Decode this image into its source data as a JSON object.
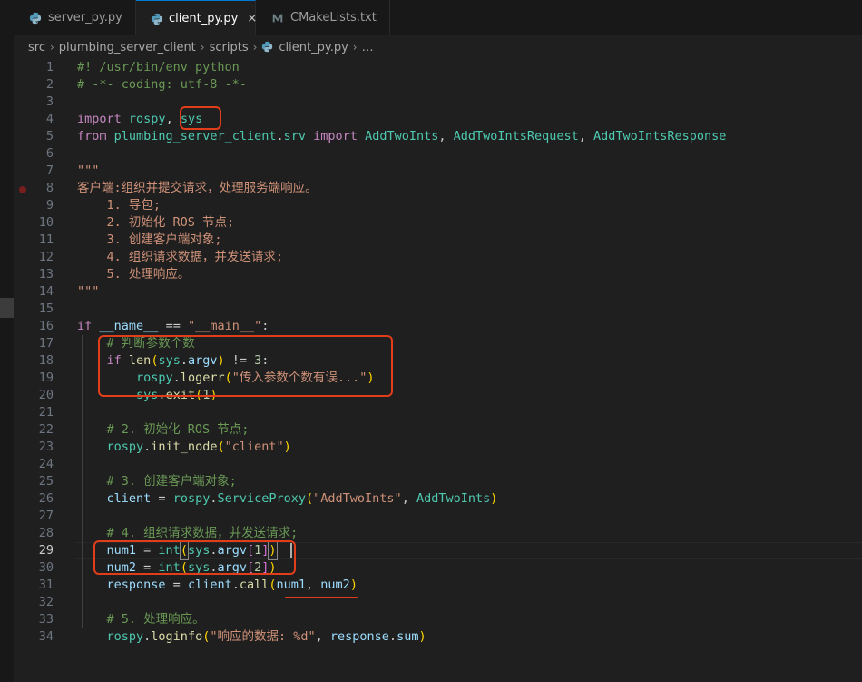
{
  "tabs": [
    {
      "label": "server_py.py",
      "icon": "python-icon"
    },
    {
      "label": "client_py.py",
      "icon": "python-icon",
      "close": "×"
    },
    {
      "label": "CMakeLists.txt",
      "icon": "cmake-icon"
    }
  ],
  "breadcrumb": {
    "parts": [
      "src",
      "plumbing_server_client",
      "scripts",
      "client_py.py",
      "…"
    ]
  },
  "active_line": 29,
  "breakpoint_line": 8,
  "colors": {
    "keyword": "#c586c0",
    "function": "#dcdcaa",
    "variable": "#9cdcfe",
    "string": "#ce9178",
    "comment": "#6a9955",
    "number": "#b5cea8",
    "class": "#4ec9b0",
    "annotation": "#e03e1a"
  },
  "lines": [
    {
      "n": "1",
      "tokens": [
        {
          "t": "#! /usr/bin/env python",
          "c": "cm"
        }
      ]
    },
    {
      "n": "2",
      "tokens": [
        {
          "t": "# -*- coding: utf-8 -*-",
          "c": "cm"
        }
      ]
    },
    {
      "n": "3",
      "tokens": []
    },
    {
      "n": "4",
      "tokens": [
        {
          "t": "import",
          "c": "kw"
        },
        {
          "t": " "
        },
        {
          "t": "rospy",
          "c": "cls"
        },
        {
          "t": ", "
        },
        {
          "t": "sys",
          "c": "cls"
        }
      ]
    },
    {
      "n": "5",
      "tokens": [
        {
          "t": "from",
          "c": "kw"
        },
        {
          "t": " "
        },
        {
          "t": "plumbing_server_client",
          "c": "cls"
        },
        {
          "t": "."
        },
        {
          "t": "srv",
          "c": "cls"
        },
        {
          "t": " "
        },
        {
          "t": "import",
          "c": "kw"
        },
        {
          "t": " "
        },
        {
          "t": "AddTwoInts",
          "c": "cls"
        },
        {
          "t": ", "
        },
        {
          "t": "AddTwoIntsRequest",
          "c": "cls"
        },
        {
          "t": ", "
        },
        {
          "t": "AddTwoIntsResponse",
          "c": "cls"
        }
      ]
    },
    {
      "n": "6",
      "tokens": []
    },
    {
      "n": "7",
      "tokens": [
        {
          "t": "\"\"\"",
          "c": "str"
        }
      ]
    },
    {
      "n": "8",
      "tokens": [
        {
          "t": "客户端:组织并提交请求，处理服务端响应。",
          "c": "str"
        }
      ]
    },
    {
      "n": "9",
      "tokens": [
        {
          "t": "    1. 导包;",
          "c": "str"
        }
      ]
    },
    {
      "n": "10",
      "tokens": [
        {
          "t": "    2. 初始化 ROS 节点;",
          "c": "str"
        }
      ]
    },
    {
      "n": "11",
      "tokens": [
        {
          "t": "    3. 创建客户端对象;",
          "c": "str"
        }
      ]
    },
    {
      "n": "12",
      "tokens": [
        {
          "t": "    4. 组织请求数据，并发送请求;",
          "c": "str"
        }
      ]
    },
    {
      "n": "13",
      "tokens": [
        {
          "t": "    5. 处理响应。",
          "c": "str"
        }
      ]
    },
    {
      "n": "14",
      "tokens": [
        {
          "t": "\"\"\"",
          "c": "str"
        }
      ]
    },
    {
      "n": "15",
      "tokens": []
    },
    {
      "n": "16",
      "tokens": [
        {
          "t": "if",
          "c": "kw"
        },
        {
          "t": " "
        },
        {
          "t": "__name__",
          "c": "var"
        },
        {
          "t": " == "
        },
        {
          "t": "\"__main__\"",
          "c": "str"
        },
        {
          "t": ":"
        }
      ]
    },
    {
      "n": "17",
      "tokens": [
        {
          "t": "    "
        },
        {
          "t": "# 判断参数个数",
          "c": "cm"
        }
      ]
    },
    {
      "n": "18",
      "tokens": [
        {
          "t": "    "
        },
        {
          "t": "if",
          "c": "kw"
        },
        {
          "t": " "
        },
        {
          "t": "len",
          "c": "fn"
        },
        {
          "t": "(",
          "c": "br1"
        },
        {
          "t": "sys",
          "c": "cls"
        },
        {
          "t": "."
        },
        {
          "t": "argv",
          "c": "var"
        },
        {
          "t": ")",
          "c": "br1"
        },
        {
          "t": " != "
        },
        {
          "t": "3",
          "c": "num"
        },
        {
          "t": ":"
        }
      ]
    },
    {
      "n": "19",
      "tokens": [
        {
          "t": "        "
        },
        {
          "t": "rospy",
          "c": "cls"
        },
        {
          "t": "."
        },
        {
          "t": "logerr",
          "c": "fn"
        },
        {
          "t": "(",
          "c": "br1"
        },
        {
          "t": "\"传入参数个数有误...\"",
          "c": "str"
        },
        {
          "t": ")",
          "c": "br1"
        }
      ]
    },
    {
      "n": "20",
      "tokens": [
        {
          "t": "        "
        },
        {
          "t": "sys",
          "c": "cls"
        },
        {
          "t": "."
        },
        {
          "t": "exit",
          "c": "fn"
        },
        {
          "t": "(",
          "c": "br1"
        },
        {
          "t": "1",
          "c": "num"
        },
        {
          "t": ")",
          "c": "br1"
        }
      ]
    },
    {
      "n": "21",
      "tokens": []
    },
    {
      "n": "22",
      "tokens": [
        {
          "t": "    "
        },
        {
          "t": "# 2. 初始化 ROS 节点;",
          "c": "cm"
        }
      ]
    },
    {
      "n": "23",
      "tokens": [
        {
          "t": "    "
        },
        {
          "t": "rospy",
          "c": "cls"
        },
        {
          "t": "."
        },
        {
          "t": "init_node",
          "c": "fn"
        },
        {
          "t": "(",
          "c": "br1"
        },
        {
          "t": "\"client\"",
          "c": "str"
        },
        {
          "t": ")",
          "c": "br1"
        }
      ]
    },
    {
      "n": "24",
      "tokens": []
    },
    {
      "n": "25",
      "tokens": [
        {
          "t": "    "
        },
        {
          "t": "# 3. 创建客户端对象;",
          "c": "cm"
        }
      ]
    },
    {
      "n": "26",
      "tokens": [
        {
          "t": "    "
        },
        {
          "t": "client",
          "c": "var"
        },
        {
          "t": " = "
        },
        {
          "t": "rospy",
          "c": "cls"
        },
        {
          "t": "."
        },
        {
          "t": "ServiceProxy",
          "c": "cls"
        },
        {
          "t": "(",
          "c": "br1"
        },
        {
          "t": "\"AddTwoInts\"",
          "c": "str"
        },
        {
          "t": ", "
        },
        {
          "t": "AddTwoInts",
          "c": "cls"
        },
        {
          "t": ")",
          "c": "br1"
        }
      ]
    },
    {
      "n": "27",
      "tokens": []
    },
    {
      "n": "28",
      "tokens": [
        {
          "t": "    "
        },
        {
          "t": "# 4. 组织请求数据，并发送请求;",
          "c": "cm"
        }
      ]
    },
    {
      "n": "29",
      "tokens": [
        {
          "t": "    "
        },
        {
          "t": "num1",
          "c": "var"
        },
        {
          "t": " = "
        },
        {
          "t": "int",
          "c": "cls"
        },
        {
          "t": "(",
          "c": "br1",
          "m": true
        },
        {
          "t": "sys",
          "c": "cls"
        },
        {
          "t": "."
        },
        {
          "t": "argv",
          "c": "var"
        },
        {
          "t": "[",
          "c": "br2"
        },
        {
          "t": "1",
          "c": "num"
        },
        {
          "t": "]",
          "c": "br2"
        },
        {
          "t": ")",
          "c": "br1",
          "m": true
        }
      ]
    },
    {
      "n": "30",
      "tokens": [
        {
          "t": "    "
        },
        {
          "t": "num2",
          "c": "var"
        },
        {
          "t": " = "
        },
        {
          "t": "int",
          "c": "cls"
        },
        {
          "t": "(",
          "c": "br1"
        },
        {
          "t": "sys",
          "c": "cls"
        },
        {
          "t": "."
        },
        {
          "t": "argv",
          "c": "var"
        },
        {
          "t": "[",
          "c": "br2"
        },
        {
          "t": "2",
          "c": "num"
        },
        {
          "t": "]",
          "c": "br2"
        },
        {
          "t": ")",
          "c": "br1"
        }
      ]
    },
    {
      "n": "31",
      "tokens": [
        {
          "t": "    "
        },
        {
          "t": "response",
          "c": "var"
        },
        {
          "t": " = "
        },
        {
          "t": "client",
          "c": "var"
        },
        {
          "t": "."
        },
        {
          "t": "call",
          "c": "fn"
        },
        {
          "t": "(",
          "c": "br1"
        },
        {
          "t": "num1",
          "c": "var"
        },
        {
          "t": ", "
        },
        {
          "t": "num2",
          "c": "var"
        },
        {
          "t": ")",
          "c": "br1"
        }
      ]
    },
    {
      "n": "32",
      "tokens": []
    },
    {
      "n": "33",
      "tokens": [
        {
          "t": "    "
        },
        {
          "t": "# 5. 处理响应。",
          "c": "cm"
        }
      ]
    },
    {
      "n": "34",
      "tokens": [
        {
          "t": "    "
        },
        {
          "t": "rospy",
          "c": "cls"
        },
        {
          "t": "."
        },
        {
          "t": "loginfo",
          "c": "fn"
        },
        {
          "t": "(",
          "c": "br1"
        },
        {
          "t": "\"响应的数据: %d\"",
          "c": "str"
        },
        {
          "t": ", "
        },
        {
          "t": "response",
          "c": "var"
        },
        {
          "t": "."
        },
        {
          "t": "sum",
          "c": "var"
        },
        {
          "t": ")",
          "c": "br1"
        }
      ]
    }
  ]
}
